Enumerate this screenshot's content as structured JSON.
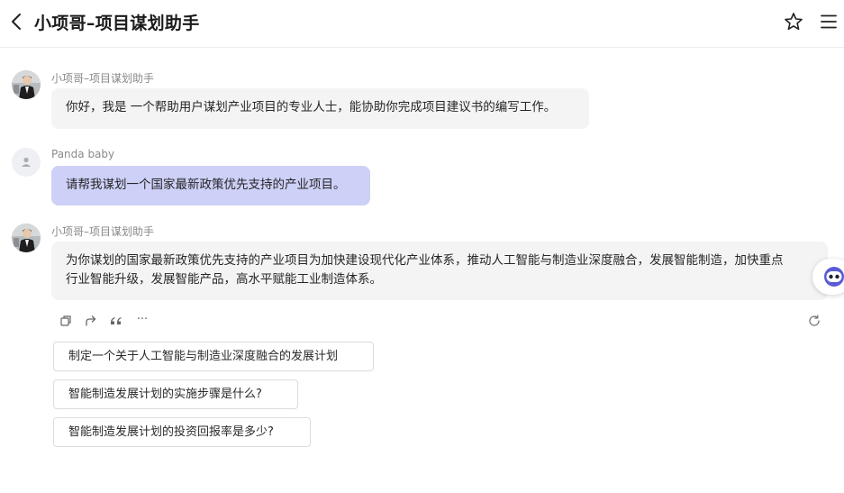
{
  "header": {
    "title": "小项哥–项目谋划助手"
  },
  "messages": [
    {
      "sender": "小项哥–项目谋划助手",
      "text": "你好，我是 一个帮助用户谋划产业项目的专业人士，能协助你完成项目建议书的编写工作。"
    },
    {
      "sender": "Panda baby",
      "text": "请帮我谋划一个国家最新政策优先支持的产业项目。"
    },
    {
      "sender": "小项哥–项目谋划助手",
      "line1": "为你谋划的国家最新政策优先支持的产业项目为加快建设现代化产业体系，推动人工智能与制造业深度融合，发展智能制造，加快重点",
      "line2": "行业智能升级，发展智能产品，高水平赋能工业制造体系。"
    }
  ],
  "actions": {
    "more_label": "···"
  },
  "suggestions": [
    "制定一个关于人工智能与制造业深度融合的发展计划",
    "智能制造发展计划的实施步骤是什么?",
    "智能制造发展计划的投资回报率是多少?"
  ],
  "colors": {
    "user_bubble": "#cdd0f7",
    "bot_bubble": "#f4f4f5",
    "accent": "#5b5bd6"
  },
  "icons": [
    "back-icon",
    "star-icon",
    "menu-icon",
    "copy-icon",
    "share-icon",
    "quote-icon",
    "more-icon",
    "refresh-icon",
    "assistant-float-icon"
  ]
}
